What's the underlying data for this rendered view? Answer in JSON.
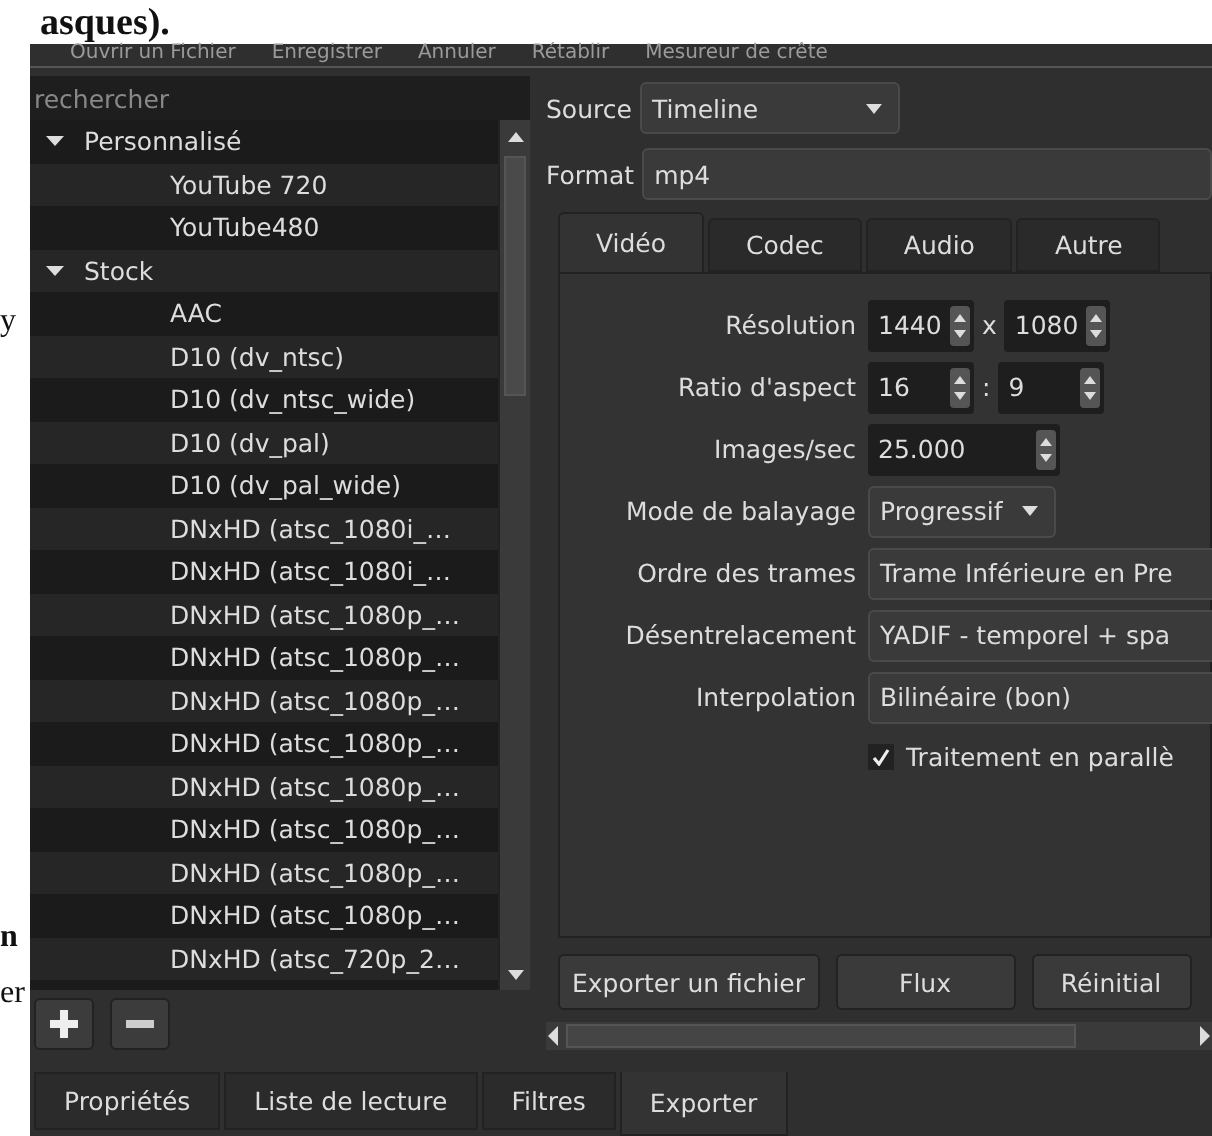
{
  "background_page": {
    "top_text": "asques).",
    "margin_texts": [
      "y",
      "n",
      "er"
    ]
  },
  "toolbar": {
    "items": [
      "Ouvrir un Fichier",
      "Enregistrer",
      "Annuler",
      "Rétablir",
      "Mesureur de crête"
    ]
  },
  "presets": {
    "search": {
      "placeholder": "rechercher"
    },
    "tree": [
      {
        "label": "Personnalisé",
        "expanded": true,
        "children": [
          {
            "label": "YouTube 720"
          },
          {
            "label": "YouTube480"
          }
        ]
      },
      {
        "label": "Stock",
        "expanded": true,
        "children": [
          {
            "label": "AAC"
          },
          {
            "label": "D10 (dv_ntsc)"
          },
          {
            "label": "D10 (dv_ntsc_wide)"
          },
          {
            "label": "D10 (dv_pal)"
          },
          {
            "label": "D10 (dv_pal_wide)"
          },
          {
            "label": "DNxHD (atsc_1080i_…"
          },
          {
            "label": "DNxHD (atsc_1080i_…"
          },
          {
            "label": "DNxHD (atsc_1080p_…"
          },
          {
            "label": "DNxHD (atsc_1080p_…"
          },
          {
            "label": "DNxHD (atsc_1080p_…"
          },
          {
            "label": "DNxHD (atsc_1080p_…"
          },
          {
            "label": "DNxHD (atsc_1080p_…"
          },
          {
            "label": "DNxHD (atsc_1080p_…"
          },
          {
            "label": "DNxHD (atsc_1080p_…"
          },
          {
            "label": "DNxHD (atsc_1080p_…"
          },
          {
            "label": "DNxHD (atsc_720p_2…"
          }
        ]
      }
    ]
  },
  "export": {
    "source": {
      "label": "Source",
      "value": "Timeline"
    },
    "format": {
      "label": "Format",
      "value": "mp4"
    },
    "tabs": [
      {
        "label": "Vidéo",
        "selected": true
      },
      {
        "label": "Codec",
        "selected": false
      },
      {
        "label": "Audio",
        "selected": false
      },
      {
        "label": "Autre",
        "selected": false
      }
    ],
    "fields": [
      {
        "kind": "spinpair",
        "label": "Résolution",
        "values": [
          "1440",
          "1080"
        ],
        "separator": "x"
      },
      {
        "kind": "spinpair",
        "label": "Ratio d'aspect",
        "values": [
          "16",
          "9"
        ],
        "separator": ":"
      },
      {
        "kind": "spin",
        "label": "Images/sec",
        "value": "25.000"
      },
      {
        "kind": "combo",
        "label": "Mode de balayage",
        "value": "Progressif"
      },
      {
        "kind": "wide",
        "label": "Ordre des trames",
        "value": "Trame Inférieure en Pre"
      },
      {
        "kind": "wide",
        "label": "Désentrelacement",
        "value": "YADIF - temporel + spa"
      },
      {
        "kind": "wide",
        "label": "Interpolation",
        "value": "Bilinéaire (bon)"
      },
      {
        "kind": "check",
        "label": "Traitement en parallè",
        "checked": true
      }
    ],
    "buttons": [
      "Exporter un fichier",
      "Flux",
      "Réinitial"
    ]
  },
  "dock_tabs": [
    {
      "label": "Propriétés",
      "selected": false
    },
    {
      "label": "Liste de lecture",
      "selected": false
    },
    {
      "label": "Filtres",
      "selected": false
    },
    {
      "label": "Exporter",
      "selected": true
    }
  ]
}
